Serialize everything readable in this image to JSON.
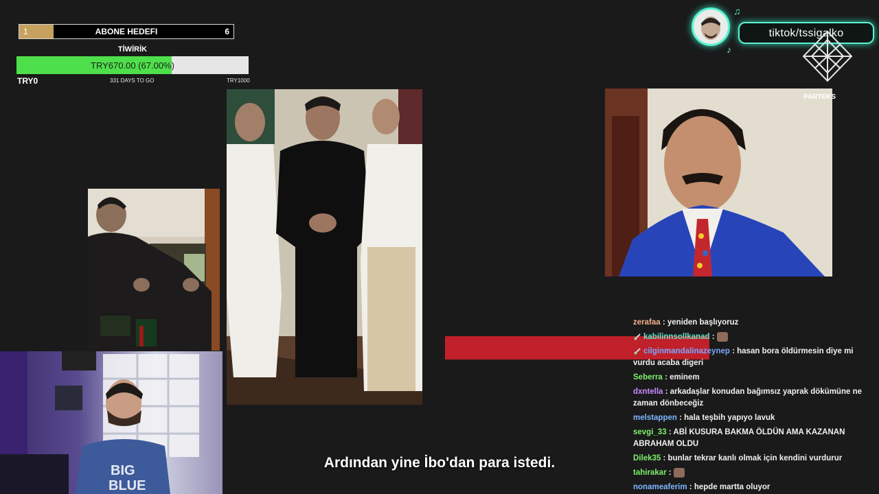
{
  "subscriber_goal": {
    "start": "1",
    "title": "ABONE HEDEFI",
    "target": "6",
    "progress_fraction": 0.16,
    "fill_color": "#c6a25e"
  },
  "donation_goal": {
    "title": "TİWİRİK",
    "amount_label": "TRY670.00 (67.00%)",
    "min_label": "TRY0",
    "days_left": "331 DAYS TO GO",
    "max_label": "TRY1000",
    "progress_percent": 67,
    "fill_color": "#4ee04a"
  },
  "tiktok": {
    "handle": "tiktok/tssigalko",
    "accent": "#5cf2d0"
  },
  "partner_label": "PARTEKS",
  "chat": {
    "messages": [
      {
        "user": "zerafaa",
        "color": "#f2b28c",
        "text": "yeniden başlıyoruz",
        "emote": false,
        "badge": false
      },
      {
        "user": "kabilinnsollkanad",
        "color": "#5fe6c6",
        "text": "",
        "emote": true,
        "badge": true
      },
      {
        "user": "cilginmandalinazeynep",
        "color": "#7aa7ff",
        "text": "hasan bora öldürmesin diye mi vurdu acaba digeri",
        "emote": false,
        "badge": true
      },
      {
        "user": "Seberra",
        "color": "#7ef06a",
        "text": "eminem",
        "emote": false,
        "badge": false
      },
      {
        "user": "dxntella",
        "color": "#c58cff",
        "text": "arkadaşlar konudan bağımsız yaprak dökümüne ne zaman dönbeceğiz",
        "emote": false,
        "badge": false
      },
      {
        "user": "melstappen",
        "color": "#7fb6ff",
        "text": "hala teşbih yapıyo lavuk",
        "emote": false,
        "badge": false
      },
      {
        "user": "sevgi_33",
        "color": "#7ef06a",
        "text": "ABİ KUSURA BAKMA ÖLDÜN AMA KAZANAN ABRAHAM OLDU",
        "emote": false,
        "badge": false
      },
      {
        "user": "Dilek35",
        "color": "#7ef06a",
        "text": "bunlar tekrar kanlı olmak için kendini vurdurur",
        "emote": false,
        "badge": false
      },
      {
        "user": "tahirakar",
        "color": "#7ef06a",
        "text": "",
        "emote": true,
        "badge": false
      },
      {
        "user": "nonameaferim",
        "color": "#7fb6ff",
        "text": "hepde martta oluyor",
        "emote": false,
        "badge": false
      }
    ]
  },
  "subtitle": "Ardından yine İbo'dan para istedi.",
  "webcam_shirt_text": [
    "BIG",
    "BLUE"
  ]
}
